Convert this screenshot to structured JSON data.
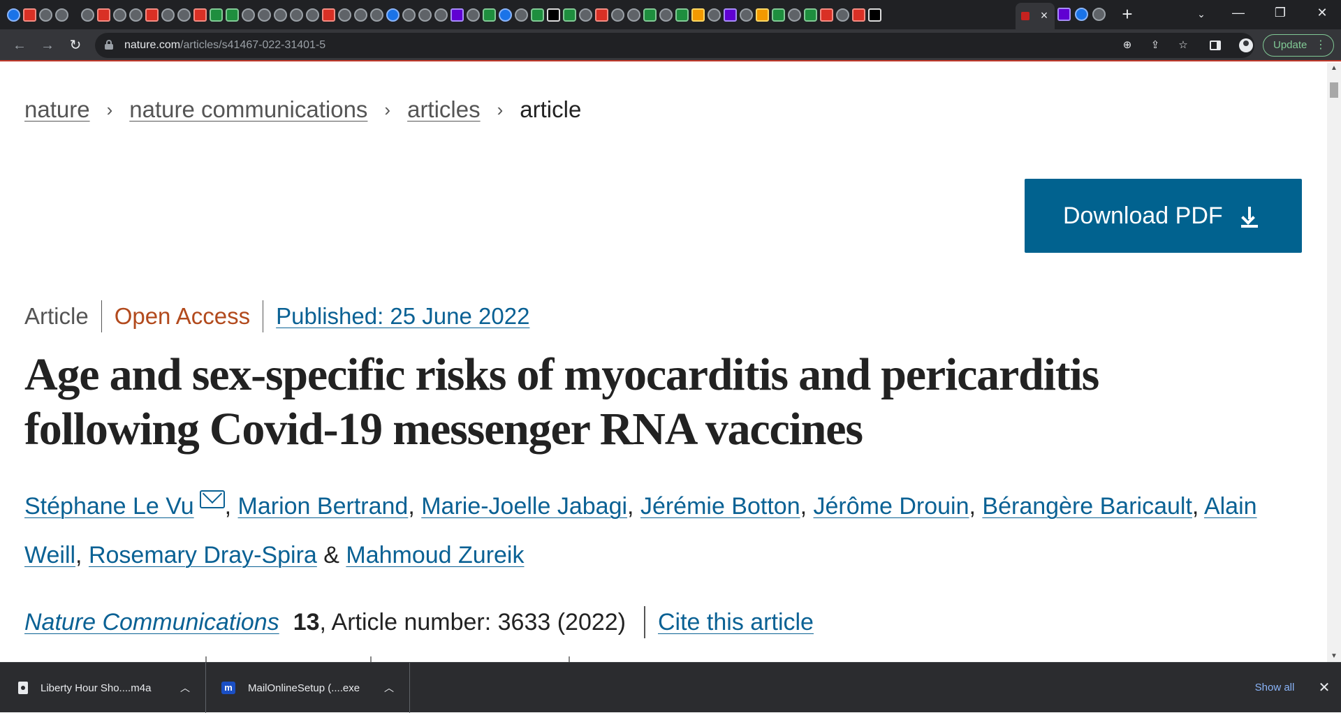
{
  "browser": {
    "url_host": "nature.com",
    "url_path": "/articles/s41467-022-31401-5",
    "update_label": "Update",
    "new_tab_symbol": "+",
    "close_tab_symbol": "×"
  },
  "breadcrumb": {
    "items": [
      "nature",
      "nature communications",
      "articles"
    ],
    "current": "article",
    "separator": "›"
  },
  "download": {
    "label": "Download PDF"
  },
  "article": {
    "type": "Article",
    "access": "Open Access",
    "published": "Published: 25 June 2022",
    "title": "Age and sex-specific risks of myocarditis and pericarditis following Covid-19 messenger RNA vaccines",
    "authors": [
      "Stéphane Le Vu",
      "Marion Bertrand",
      "Marie-Joelle Jabagi",
      "Jérémie Botton",
      "Jérôme Drouin",
      "Bérangère Baricault",
      "Alain Weill",
      "Rosemary Dray-Spira",
      "Mahmoud Zureik"
    ],
    "journal": "Nature Communications",
    "volume": "13",
    "article_number": ", Article number: 3633 (2022)",
    "cite_label": "Cite this article"
  },
  "downloads_shelf": {
    "items": [
      {
        "name": "Liberty Hour Sho....m4a",
        "icon": "audio-file-icon"
      },
      {
        "name": "MailOnlineSetup (....exe",
        "icon": "mailonline-app-icon"
      }
    ],
    "show_all_label": "Show all"
  },
  "colors": {
    "link": "#0a6194",
    "open_access": "#b24a1d",
    "download_button": "#01628f",
    "chrome_dark": "#202124",
    "chrome_toolbar": "#35363a"
  }
}
